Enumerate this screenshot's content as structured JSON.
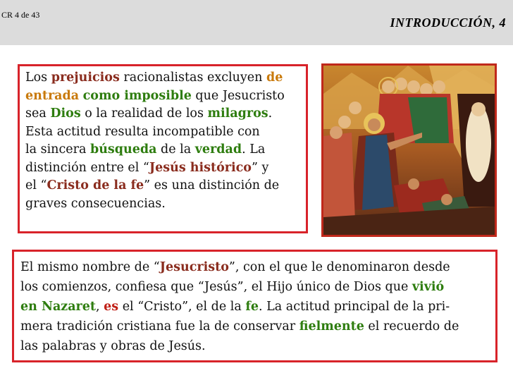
{
  "header": {
    "slide_counter": "CR 4 de 43",
    "title": "INTRODUCCIÓN, 4"
  },
  "box1": {
    "lines": [
      [
        {
          "t": "Los "
        },
        {
          "t": "prejuicios",
          "c": "brown"
        },
        {
          "t": " racionalistas excluyen "
        },
        {
          "t": "de",
          "c": "orange"
        }
      ],
      [
        {
          "t": "entrada",
          "c": "orange"
        },
        {
          "t": " "
        },
        {
          "t": "como imposible",
          "c": "green"
        },
        {
          "t": " que Jesucristo"
        }
      ],
      [
        {
          "t": "sea "
        },
        {
          "t": "Dios",
          "c": "green"
        },
        {
          "t": " o la realidad de los "
        },
        {
          "t": "milagros",
          "c": "green"
        },
        {
          "t": "."
        }
      ],
      [
        {
          "t": "Esta actitud resulta incompatible con"
        }
      ],
      [
        {
          "t": "la sincera "
        },
        {
          "t": "búsqueda",
          "c": "green"
        },
        {
          "t": " de la "
        },
        {
          "t": "verdad",
          "c": "green"
        },
        {
          "t": ". La"
        }
      ],
      [
        {
          "t": "distinción entre el “"
        },
        {
          "t": "Jesús histórico",
          "c": "brown"
        },
        {
          "t": "” y"
        }
      ],
      [
        {
          "t": "el “"
        },
        {
          "t": "Cristo de la fe",
          "c": "brown"
        },
        {
          "t": "” es una distinción de"
        }
      ],
      [
        {
          "t": "graves consecuencias."
        }
      ]
    ]
  },
  "box2": {
    "lines": [
      [
        {
          "t": "El mismo nombre de “"
        },
        {
          "t": "Jesucristo",
          "c": "brown"
        },
        {
          "t": "”, con el que le denominaron desde"
        }
      ],
      [
        {
          "t": "los comienzos, confiesa que “Jesús”, el Hijo único de Dios que "
        },
        {
          "t": "vivió",
          "c": "green"
        }
      ],
      [
        {
          "t": "en Nazaret",
          "c": "green"
        },
        {
          "t": ", "
        },
        {
          "t": "es",
          "c": "red"
        },
        {
          "t": " el “Cristo”, el de la "
        },
        {
          "t": "fe",
          "c": "green"
        },
        {
          "t": ". La actitud principal de la pri-"
        }
      ],
      [
        {
          "t": "mera tradición cristiana fue la de conservar "
        },
        {
          "t": "fielmente",
          "c": "green"
        },
        {
          "t": " el recuerdo de"
        }
      ],
      [
        {
          "t": "las palabras y obras de Jesús."
        }
      ]
    ]
  },
  "image": {
    "icon_name": "icon-resurrection-of-lazarus-image"
  },
  "colors": {
    "frame_red": "#d8232a",
    "header_gray": "#dcdcdc",
    "brown_highlight": "#8a2c1e",
    "green_highlight": "#2e7d0f",
    "red_highlight": "#c01f16",
    "orange_highlight": "#c97a0c"
  }
}
